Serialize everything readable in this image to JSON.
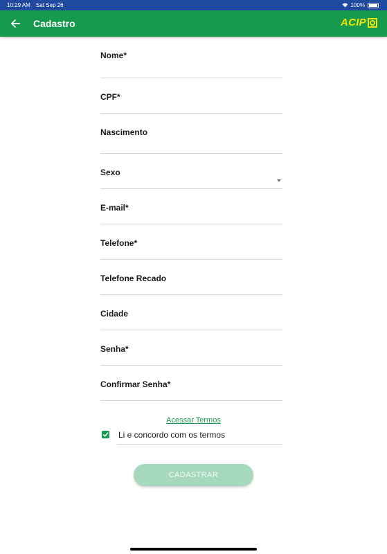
{
  "status_bar": {
    "time": "10:29 AM",
    "date": "Sat Sep 26",
    "battery": "100%"
  },
  "app_bar": {
    "title": "Cadastro",
    "logo_text": "ACIP",
    "back_icon": "arrow-left-icon"
  },
  "form": {
    "fields": [
      {
        "label": "Nome*",
        "value": ""
      },
      {
        "label": "CPF*",
        "value": ""
      },
      {
        "label": "Nascimento",
        "value": ""
      },
      {
        "label": "Sexo",
        "value": ""
      },
      {
        "label": "E-mail*",
        "value": ""
      },
      {
        "label": "Telefone*",
        "value": ""
      },
      {
        "label": "Telefone Recado",
        "value": ""
      },
      {
        "label": "Cidade",
        "value": ""
      },
      {
        "label": "Senha*",
        "value": ""
      },
      {
        "label": "Confirmar Senha*",
        "value": ""
      }
    ]
  },
  "terms": {
    "link_text": "Acessar Termos",
    "checkbox_label": "Li e concordo com os termos",
    "checked": true
  },
  "submit": {
    "label": "CADASTRAR"
  },
  "colors": {
    "primary": "#169a4e",
    "status_bar": "#1f4aa0",
    "logo": "#f5e400",
    "button_disabled": "#a6d8bd"
  }
}
